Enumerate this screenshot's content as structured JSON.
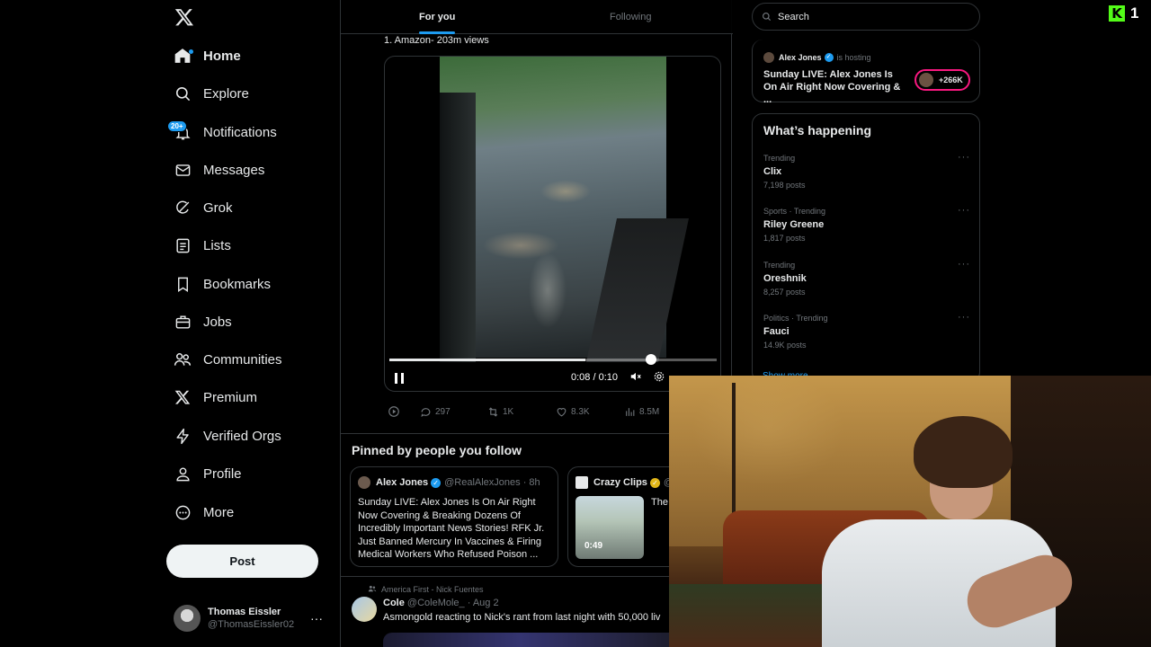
{
  "sidebar": {
    "logo_icon": "x-logo",
    "items": [
      {
        "label": "Home",
        "icon": "home-icon",
        "active": true
      },
      {
        "label": "Explore",
        "icon": "search-icon"
      },
      {
        "label": "Notifications",
        "icon": "bell-icon",
        "badge": "20+"
      },
      {
        "label": "Messages",
        "icon": "envelope-icon"
      },
      {
        "label": "Grok",
        "icon": "grok-icon"
      },
      {
        "label": "Lists",
        "icon": "list-icon"
      },
      {
        "label": "Bookmarks",
        "icon": "bookmark-icon"
      },
      {
        "label": "Jobs",
        "icon": "briefcase-icon"
      },
      {
        "label": "Communities",
        "icon": "people-icon"
      },
      {
        "label": "Premium",
        "icon": "x-icon"
      },
      {
        "label": "Verified Orgs",
        "icon": "lightning-icon"
      },
      {
        "label": "Profile",
        "icon": "user-icon"
      },
      {
        "label": "More",
        "icon": "more-circle-icon"
      }
    ],
    "post_button": "Post",
    "account": {
      "name": "Thomas Eissler",
      "handle": "@ThomasEissler02",
      "more": "···"
    }
  },
  "main": {
    "tabs": [
      {
        "label": "For you",
        "active": true
      },
      {
        "label": "Following"
      }
    ],
    "post": {
      "text": "1. Amazon- 203m views",
      "video": {
        "time": "0:08 / 0:10",
        "progress": 0.8,
        "buffered": 0.6
      },
      "actions": {
        "replies": "297",
        "reposts": "1K",
        "likes": "8.3K",
        "views": "8.5M"
      }
    },
    "pinned": {
      "title": "Pinned by people you follow",
      "cards": [
        {
          "name": "Alex Jones",
          "handle": "@RealAlexJones · 8h",
          "text": "Sunday LIVE: Alex Jones Is On Air Right Now Covering & Breaking Dozens Of Incredibly Important News Stories! RFK Jr. Just Banned Mercury In Vaccines & Firing Medical Workers Who Refused Poison ..."
        },
        {
          "name": "Crazy Clips",
          "handle": "@",
          "text": "The alwa",
          "duration": "0:49"
        }
      ]
    },
    "next_post": {
      "context": "America First - Nick Fuentes",
      "name": "Cole",
      "handle": "@ColeMole_ · Aug 2",
      "text": "Asmongold reacting to Nick's rant from last night with 50,000 liv"
    }
  },
  "right": {
    "search_placeholder": "Search",
    "host": {
      "name": "Alex Jones",
      "sub": "is hosting",
      "title": "Sunday LIVE: Alex Jones Is On Air Right Now Covering & ...",
      "listeners": "+266K"
    },
    "trends_title": "What’s happening",
    "trends": [
      {
        "meta": "Trending",
        "name": "Clix",
        "count": "7,198 posts"
      },
      {
        "meta": "Sports · Trending",
        "name": "Riley Greene",
        "count": "1,817 posts"
      },
      {
        "meta": "Trending",
        "name": "Oreshnik",
        "count": "8,257 posts"
      },
      {
        "meta": "Politics · Trending",
        "name": "Fauci",
        "count": "14.9K posts"
      }
    ],
    "show_more": "Show more",
    "trend_more": "···"
  },
  "overlay": {
    "kick_viewers": "1",
    "kick_logo": "K"
  },
  "colors": {
    "accent": "#1d9bf0",
    "live": "#f91880",
    "kick": "#53fc18",
    "verified_gold": "#e2b719"
  }
}
